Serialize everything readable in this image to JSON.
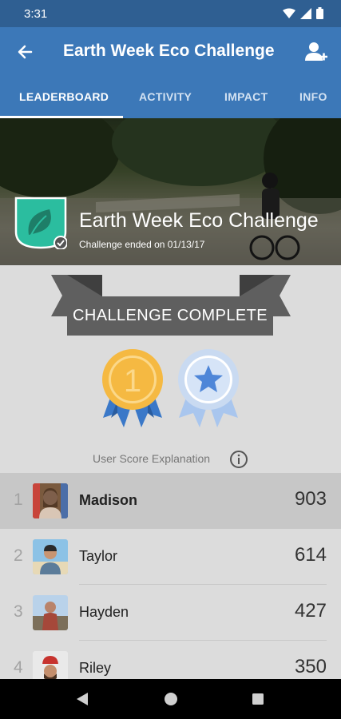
{
  "status_bar": {
    "time": "3:31"
  },
  "app_bar": {
    "title": "Earth Week Eco Challenge"
  },
  "tabs": [
    {
      "label": "LEADERBOARD",
      "active": true
    },
    {
      "label": "ACTIVITY",
      "active": false
    },
    {
      "label": "IMPACT",
      "active": false
    },
    {
      "label": "INFO",
      "active": false
    }
  ],
  "hero": {
    "title": "Earth Week Eco Challenge",
    "subtitle": "Challenge ended on 01/13/17"
  },
  "banner": {
    "text": "CHALLENGE COMPLETE"
  },
  "medals": [
    {
      "label": "1",
      "color": "#f5b942"
    },
    {
      "label": "",
      "color": "#d6e4f7"
    }
  ],
  "score_explanation": {
    "label": "User Score Explanation"
  },
  "leaderboard": [
    {
      "rank": "1",
      "name": "Madison",
      "score": "903",
      "highlight": true
    },
    {
      "rank": "2",
      "name": "Taylor",
      "score": "614",
      "highlight": false
    },
    {
      "rank": "3",
      "name": "Hayden",
      "score": "427",
      "highlight": false
    },
    {
      "rank": "4",
      "name": "Riley",
      "score": "350",
      "highlight": false
    }
  ],
  "colors": {
    "primary": "#3c78b8",
    "status_bar": "#2f5f92",
    "badge_green": "#2bbd9f",
    "banner_gray": "#5f5f5f",
    "gold": "#f5b942",
    "ribbon_blue": "#3a78c8"
  }
}
